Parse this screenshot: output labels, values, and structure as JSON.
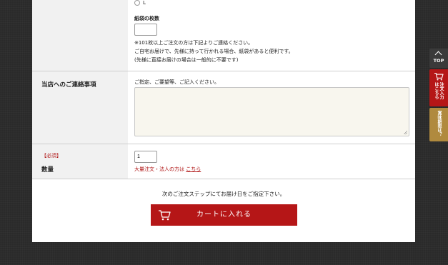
{
  "form": {
    "radio_option_l": "L",
    "bag_count_label": "紙袋の枚数",
    "bag_count_value": "",
    "bag_note_1": "※101枚以上ご注文の方は下記よりご連絡ください。",
    "bag_note_2": "ご自宅お届けで、先様に持って行かれる場合、紙袋があると便利です。",
    "bag_note_3": "(先様に直接お届けの場合は一般的に不要です)",
    "contact_label": "当店へのご連絡事項",
    "contact_instruction": "ご指定、ご要望等、ご記入ください。",
    "contact_value": "",
    "required_badge": "【必須】",
    "quantity_label": "数量",
    "quantity_value": "1",
    "bulk_note": "大量注文・法人の方は",
    "bulk_link": "こちら"
  },
  "footer": {
    "next_step_note": "次のご注文ステップにてお届け日をご指定下さい。",
    "add_to_cart_label": "カートに入れる"
  },
  "side_nav": {
    "top_label": "TOP",
    "order_label_1": "注文入力",
    "order_label_2": "はこちら",
    "gift_label": "賞味期限は？"
  },
  "colors": {
    "accent_red": "#b51617",
    "gold": "#b08a3e",
    "background_dark": "#2a2a2a"
  }
}
